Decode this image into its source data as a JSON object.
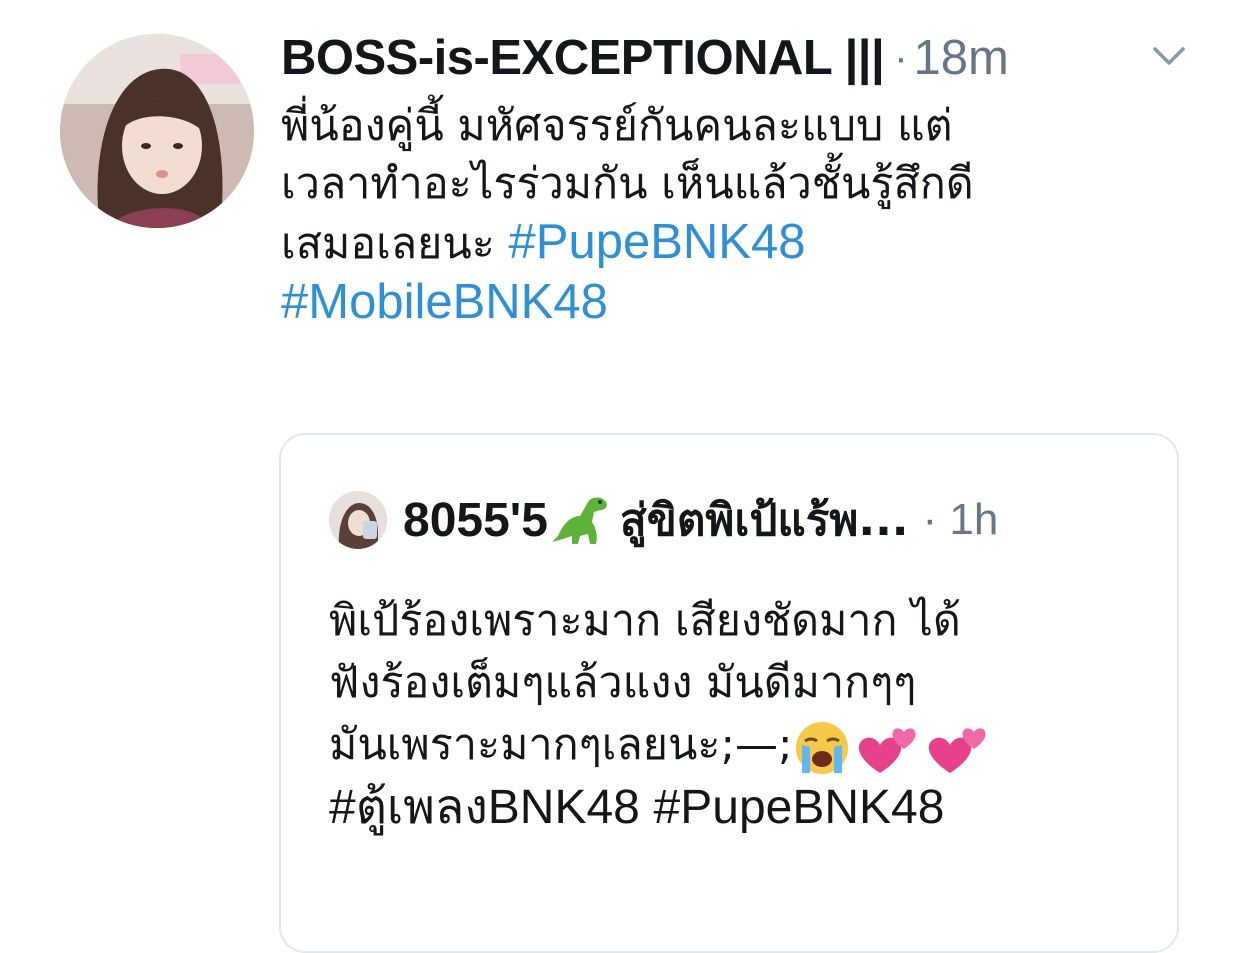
{
  "tweet": {
    "display_name": "BOSS-is-EXCEPTIONAL |||",
    "separator": "·",
    "timestamp": "18m",
    "text_lines": [
      "พี่น้องคู่นี้ มหัศจรรย์กันคนละแบบ แต่",
      "เวลาทำอะไรร่วมกัน เห็นแล้วชั้นรู้สึกดี",
      "เสมอเลยนะ "
    ],
    "hashtags": [
      "#PupeBNK48",
      "#MobileBNK48"
    ],
    "menu_icon": "chevron-down-icon"
  },
  "quoted_tweet": {
    "name_prefix": "8055'5",
    "name_suffix": "สู่ขิตพิเป้แร้พ...",
    "name_emoji": "dinosaur-icon",
    "separator": "·",
    "timestamp": "1h",
    "text_lines": [
      "พิเป้ร้องเพราะมาก เสียงชัดมาก ได้",
      "ฟังร้องเต็มๆแล้วแงง มันดีมากๆๆ",
      "มันเพราะมากๆเลยนะ;—;"
    ],
    "emojis": [
      "loudly-crying-face-icon",
      "two-hearts-icon",
      "two-hearts-icon"
    ],
    "hashtags": [
      "#ตู้เพลงBNK48",
      "#PupeBNK48"
    ]
  },
  "colors": {
    "hashtag": "#2b90d9",
    "text": "#14171a",
    "muted": "#657786",
    "border": "#e1e8ed"
  }
}
